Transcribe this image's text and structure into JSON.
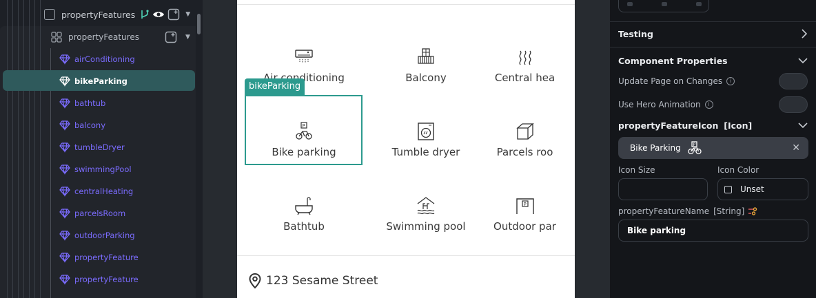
{
  "tree": {
    "root_label": "propertyFeatures",
    "container_label": "propertyFeatures",
    "children": [
      "airConditioning",
      "bikeParking",
      "bathtub",
      "balcony",
      "tumbleDryer",
      "swimmingPool",
      "centralHeating",
      "parcelsRoom",
      "outdoorParking",
      "propertyFeature",
      "propertyFeature"
    ],
    "selected_index": 1
  },
  "canvas": {
    "tiles": [
      {
        "label": "Air conditioning",
        "icon": "air-conditioner-icon"
      },
      {
        "label": "Balcony",
        "icon": "balcony-icon"
      },
      {
        "label": "Central hea",
        "icon": "heating-icon"
      },
      {
        "label": "Bike parking",
        "icon": "bike-parking-icon"
      },
      {
        "label": "Tumble dryer",
        "icon": "tumble-dryer-icon"
      },
      {
        "label": "Parcels roo",
        "icon": "parcel-icon"
      },
      {
        "label": "Bathtub",
        "icon": "bathtub-icon"
      },
      {
        "label": "Swimming pool",
        "icon": "pool-icon"
      },
      {
        "label": "Outdoor par",
        "icon": "outdoor-parking-icon"
      }
    ],
    "selected_tag": "bikeParking",
    "address": "123 Sesame Street"
  },
  "panel": {
    "testing": "Testing",
    "component_properties": "Component Properties",
    "update_page": "Update Page on Changes",
    "hero_animation": "Use Hero Animation",
    "icon_prop": {
      "name": "propertyFeatureIcon",
      "type": "[Icon]"
    },
    "icon_value": "Bike Parking",
    "icon_size_label": "Icon Size",
    "icon_color_label": "Icon Color",
    "icon_color_value": "Unset",
    "name_prop": {
      "name": "propertyFeatureName",
      "type": "[String]"
    },
    "name_value": "Bike parking"
  },
  "colors": {
    "accent": "#2c9a8e",
    "child": "#7b6cff",
    "selected_row": "#2f5a5c"
  }
}
